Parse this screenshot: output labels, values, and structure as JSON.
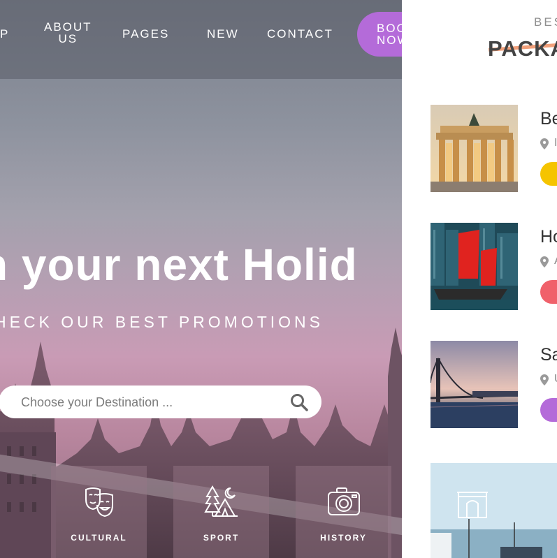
{
  "nav": {
    "items": [
      {
        "label": "P"
      },
      {
        "label": "ABOUT\nUS"
      },
      {
        "label": "PAGES"
      },
      {
        "label": "NEW"
      },
      {
        "label": "CONTACT"
      }
    ],
    "book_label": "BOOK\nNOW"
  },
  "hero": {
    "title": "h your next Holid",
    "subtitle": "HECK OUR BEST PROMOTIONS",
    "search": {
      "placeholder": "Choose your Destination ..."
    }
  },
  "categories": [
    {
      "label": "CULTURAL",
      "icon": "theater-masks-icon"
    },
    {
      "label": "SPORT",
      "icon": "camping-icon"
    },
    {
      "label": "HISTORY",
      "icon": "camera-icon"
    }
  ],
  "sidebar": {
    "kicker": "BES",
    "heading": "PACKA",
    "packages": [
      {
        "title": "Be",
        "location": "I",
        "tag_color": "#f5c400"
      },
      {
        "title": "Ho",
        "location": "A",
        "tag_color": "#f0616b"
      },
      {
        "title": "Sa",
        "location": "U",
        "tag_color": "#b46bd9"
      }
    ]
  },
  "colors": {
    "accent": "#b46bd9",
    "heading_underline": "#f2a07a"
  }
}
